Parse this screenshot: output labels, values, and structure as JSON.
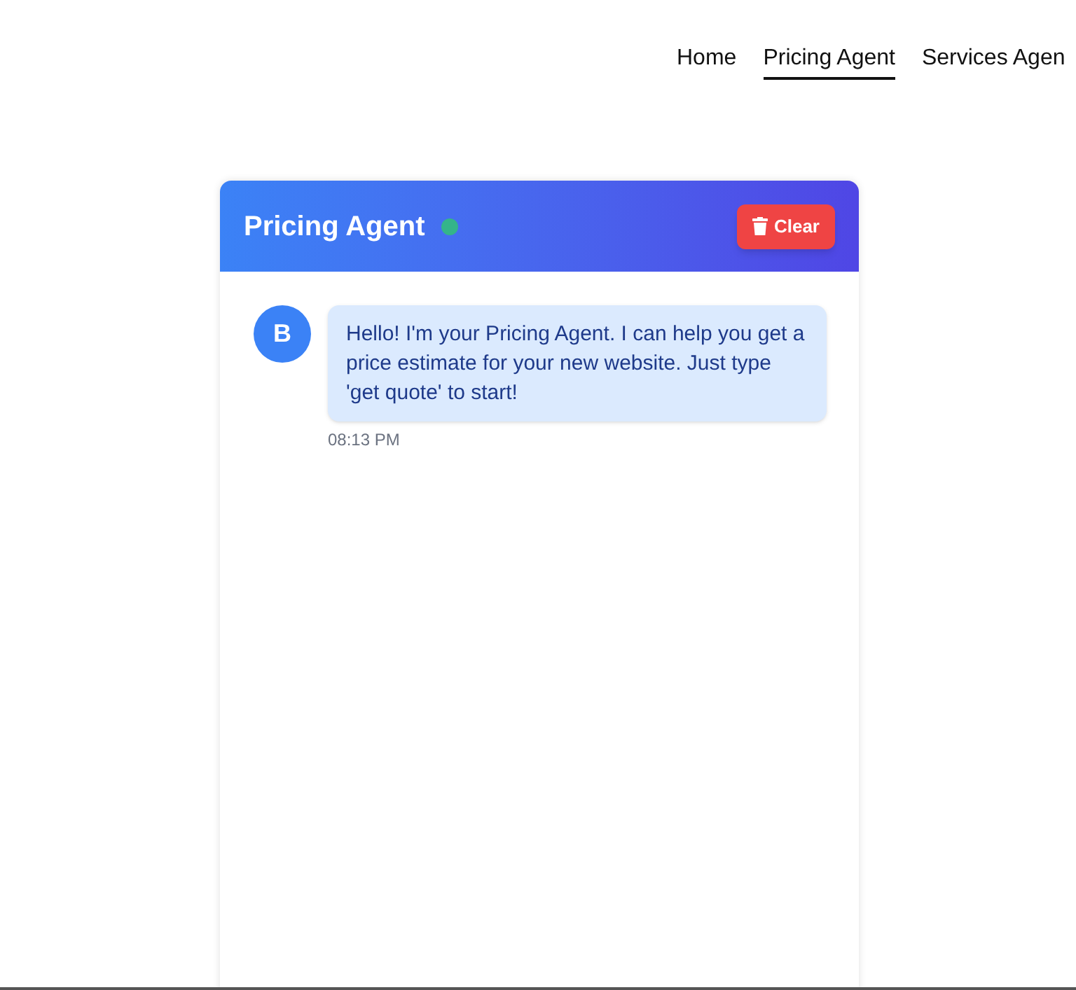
{
  "nav": [
    {
      "label": "Home",
      "selected": false
    },
    {
      "label": "Pricing Agent",
      "selected": true
    },
    {
      "label": "Services Agen",
      "selected": false
    }
  ],
  "chat": {
    "title": "Pricing Agent",
    "online": true,
    "clear_button": "Clear",
    "messages": [
      {
        "avatar": "B",
        "text": "Hello! I'm your Pricing Agent. I can help you get a price estimate for your new website. Just type 'get quote' to start!",
        "time": "08:13 PM"
      }
    ]
  }
}
